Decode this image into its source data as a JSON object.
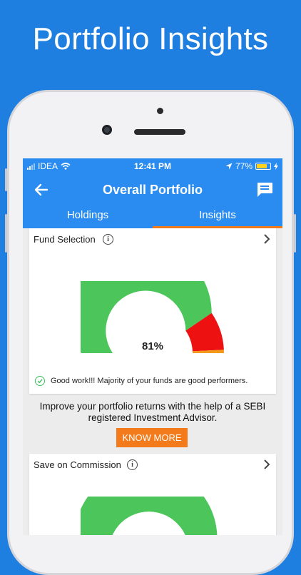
{
  "headline": "Portfolio Insights",
  "status_bar": {
    "carrier": "IDEA",
    "time": "12:41 PM",
    "battery": "77%",
    "battery_level": 0.77
  },
  "app_bar": {
    "title": "Overall Portfolio",
    "tabs": [
      {
        "label": "Holdings",
        "active": false
      },
      {
        "label": "Insights",
        "active": true
      }
    ]
  },
  "fund_selection": {
    "title": "Fund Selection",
    "percent_label": "81%",
    "score": 0.81,
    "message": "Good work!!! Majority of your funds are good performers."
  },
  "promo": {
    "line1": "Improve your portfolio returns with the help of a SEBI",
    "line2": "registered Investment Advisor.",
    "button_label": "KNOW MORE"
  },
  "commission": {
    "title": "Save on Commission"
  },
  "colors": {
    "brand_blue": "#2a8cf0",
    "accent_orange": "#f37b1c",
    "gauge_green": "#4cc55a",
    "gauge_red": "#ee1111",
    "gauge_orange": "#f39a1c"
  },
  "icons": {
    "back": "back-arrow-icon",
    "chat": "chat-icon",
    "info": "info-icon",
    "chevron": "chevron-right-icon",
    "check": "check-circle-icon"
  }
}
